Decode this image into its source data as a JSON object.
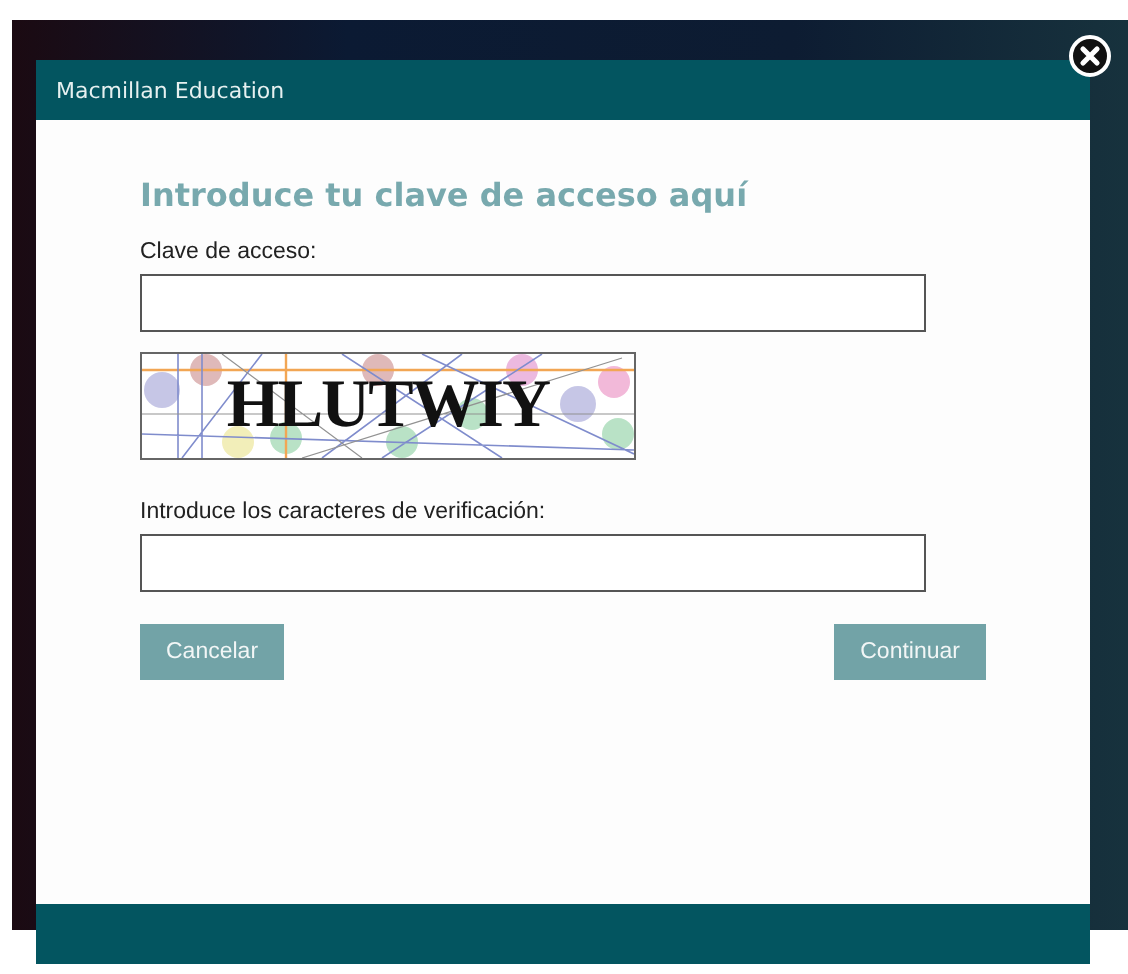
{
  "dialog": {
    "title": "Macmillan Education",
    "heading": "Introduce tu clave de acceso aquí",
    "fields": [
      {
        "kind": "text",
        "label": "Clave de acceso:"
      },
      {
        "kind": "captcha",
        "captcha_text": "HLUTWIY"
      },
      {
        "kind": "text",
        "label": "Introduce los caracteres de verificación:"
      }
    ],
    "buttons": [
      "Cancelar",
      "Continuar"
    ]
  }
}
